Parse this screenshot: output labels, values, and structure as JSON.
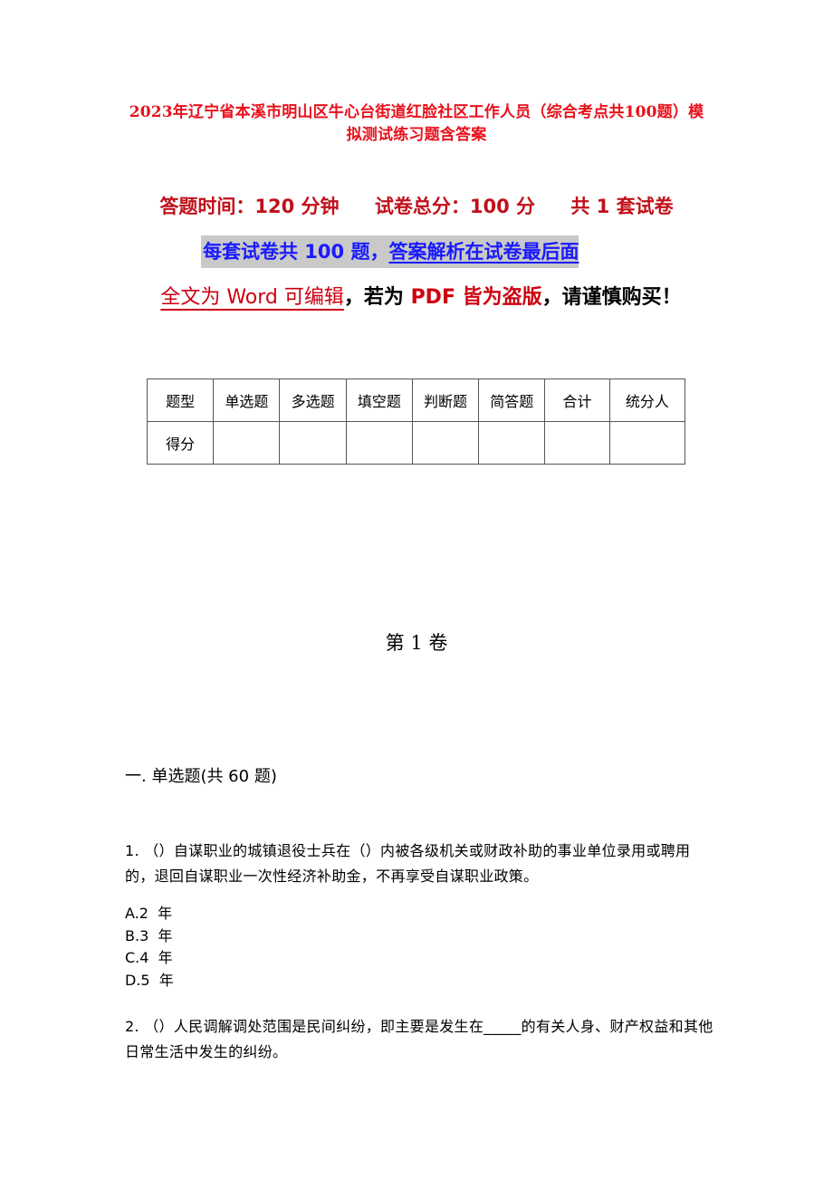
{
  "document": {
    "title": "2023年辽宁省本溪市明山区牛心台街道红脸社区工作人员（综合考点共100题）模拟测试练习题含答案",
    "meta": {
      "time": "答题时间：120 分钟",
      "total_score": "试卷总分：100 分",
      "sets": "共 1 套试卷"
    },
    "highlight": {
      "part1": "每套试卷共 100 题，",
      "part2": "答案解析在试卷最后面"
    },
    "notice": {
      "editable": "全文为 Word 可编辑",
      "comma1": "，若为 ",
      "pdf": "PDF 皆为盗版",
      "rest": "，请谨慎购买！"
    },
    "score_table": {
      "header": [
        "题型",
        "单选题",
        "多选题",
        "填空题",
        "判断题",
        "简答题",
        "合计",
        "统分人"
      ],
      "row_label": "得分",
      "row_values": [
        "",
        "",
        "",
        "",
        "",
        "",
        ""
      ]
    },
    "volume": "第 1 卷",
    "section": "一. 单选题(共 60 题)",
    "questions": [
      {
        "text": "1. （）自谋职业的城镇退役士兵在（）内被各级机关或财政补助的事业单位录用或聘用的，退回自谋职业一次性经济补助金，不再享受自谋职业政策。",
        "options": [
          "A.2  年",
          "B.3  年",
          "C.4  年",
          "D.5  年"
        ]
      },
      {
        "text": "2. （）人民调解调处范围是民间纠纷，即主要是发生在_____的有关人身、财产权益和其他日常生活中发生的纠纷。",
        "options": []
      }
    ]
  }
}
